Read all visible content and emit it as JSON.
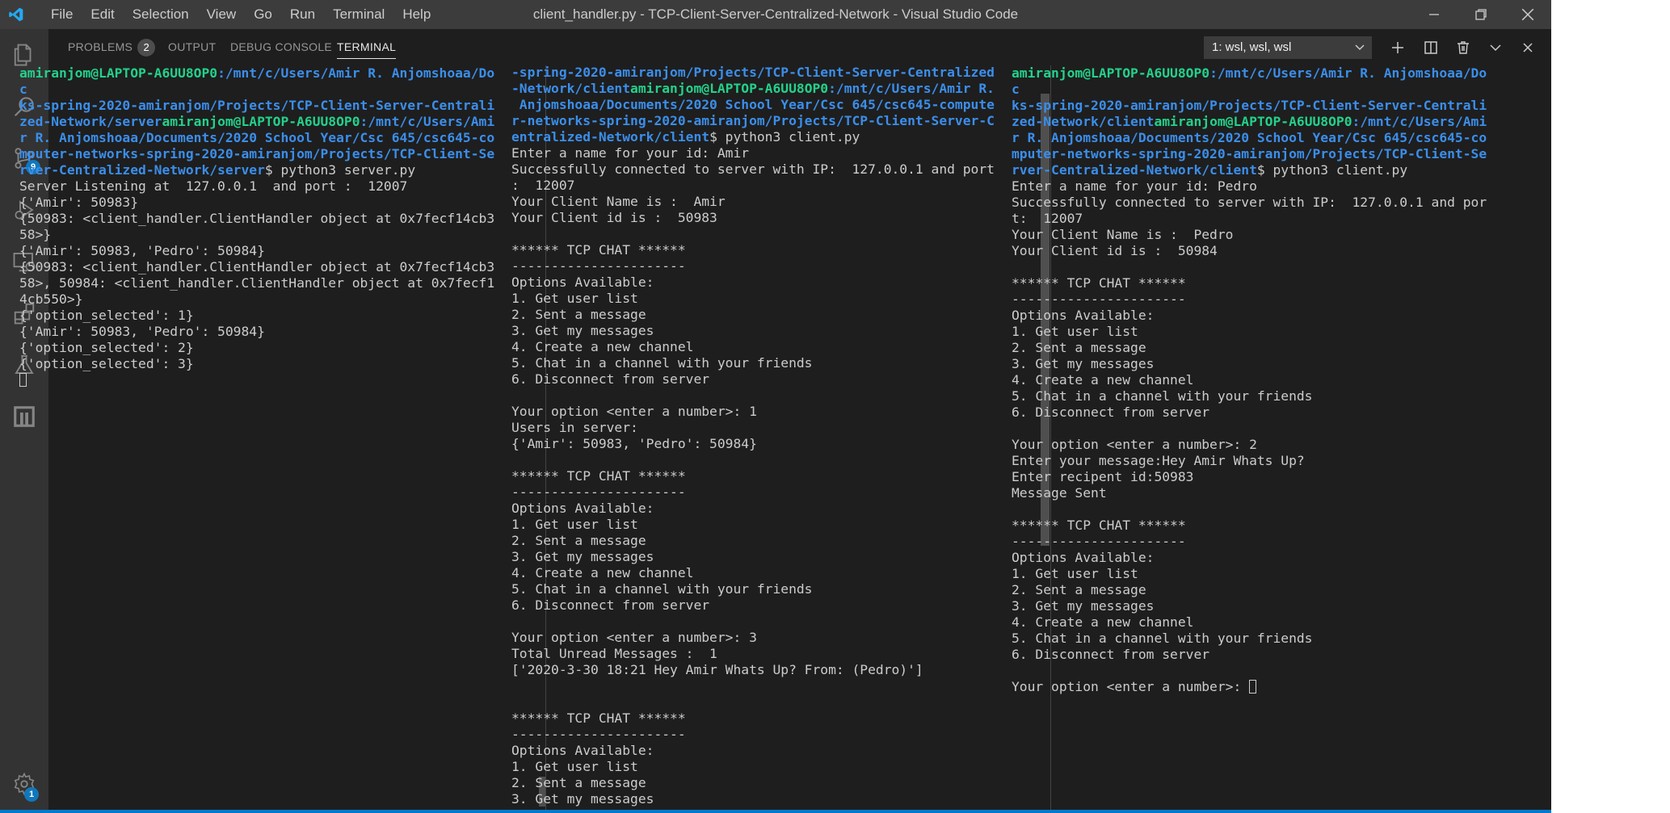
{
  "window": {
    "title": "client_handler.py - TCP-Client-Server-Centralized-Network - Visual Studio Code",
    "menus": [
      "File",
      "Edit",
      "Selection",
      "View",
      "Go",
      "Run",
      "Terminal",
      "Help"
    ]
  },
  "activity": {
    "scm_badge": "9",
    "settings_badge": "1"
  },
  "panel": {
    "tabs": {
      "problems": "PROBLEMS",
      "problems_count": "2",
      "output": "OUTPUT",
      "debug": "DEBUG CONSOLE",
      "terminal": "TERMINAL"
    },
    "terminal_select": "1: wsl, wsl, wsl"
  },
  "terminals": {
    "server": {
      "lines": [
        [
          {
            "t": "amiranjom@LAPTOP-A6UU8OP0",
            "c": "u"
          },
          {
            "t": ":/mnt/c/Users/Amir R. Anjomshoaa/Do",
            "c": "p"
          }
        ],
        [
          {
            "t": "c",
            "c": "p"
          }
        ],
        [
          {
            "t": "ks-spring-2020-amiranjom/Projects/TCP-Client-Server-Centrali",
            "c": "p"
          }
        ],
        [
          {
            "t": "zed-Network/server",
            "c": "p"
          },
          {
            "t": "amiranjom@LAPTOP-A6UU8OP0",
            "c": "u"
          },
          {
            "t": ":/mnt/c/Users/Ami",
            "c": "p"
          }
        ],
        [
          {
            "t": "r R. Anjomshoaa/Documents/2020 School Year/Csc 645/csc645-co",
            "c": "p"
          }
        ],
        [
          {
            "t": "mputer-networks-spring-2020-amiranjom/Projects/TCP-Client-Se",
            "c": "p"
          }
        ],
        [
          {
            "t": "rver-Centralized-Network/server",
            "c": "p"
          },
          {
            "t": "$ python3 server.py",
            "c": ""
          }
        ],
        [
          {
            "t": "Server Listening at  127.0.0.1  and port :  12007",
            "c": ""
          }
        ],
        [
          {
            "t": "{'Amir': 50983}",
            "c": ""
          }
        ],
        [
          {
            "t": "{50983: <client_handler.ClientHandler object at 0x7fecf14cb3",
            "c": ""
          }
        ],
        [
          {
            "t": "58>}",
            "c": ""
          }
        ],
        [
          {
            "t": "{'Amir': 50983, 'Pedro': 50984}",
            "c": ""
          }
        ],
        [
          {
            "t": "{50983: <client_handler.ClientHandler object at 0x7fecf14cb3",
            "c": ""
          }
        ],
        [
          {
            "t": "58>, 50984: <client_handler.ClientHandler object at 0x7fecf1",
            "c": ""
          }
        ],
        [
          {
            "t": "4cb550>}",
            "c": ""
          }
        ],
        [
          {
            "t": "{'option_selected': 1}",
            "c": ""
          }
        ],
        [
          {
            "t": "{'Amir': 50983, 'Pedro': 50984}",
            "c": ""
          }
        ],
        [
          {
            "t": "{'option_selected': 2}",
            "c": ""
          }
        ],
        [
          {
            "t": "{'option_selected': 3}",
            "c": ""
          }
        ],
        [
          {
            "cursor": true
          }
        ]
      ]
    },
    "client_amir": {
      "lines": [
        [
          {
            "t": "-spring-2020-amiranjom/Projects/TCP-Client-Server-Centralized",
            "c": "p"
          }
        ],
        [
          {
            "t": "-Network/client",
            "c": "p"
          },
          {
            "t": "amiranjom@LAPTOP-A6UU8OP0",
            "c": "u"
          },
          {
            "t": ":/mnt/c/Users/Amir R.",
            "c": "p"
          }
        ],
        [
          {
            "t": " Anjomshoaa/Documents/2020 School Year/Csc 645/csc645-compute",
            "c": "p"
          }
        ],
        [
          {
            "t": "r-networks-spring-2020-amiranjom/Projects/TCP-Client-Server-C",
            "c": "p"
          }
        ],
        [
          {
            "t": "entralized-Network/client",
            "c": "p"
          },
          {
            "t": "$ python3 client.py",
            "c": ""
          }
        ],
        [
          {
            "t": "Enter a name for your id: Amir",
            "c": ""
          }
        ],
        [
          {
            "t": "Successfully connected to server with IP:  127.0.0.1 and port",
            "c": ""
          }
        ],
        [
          {
            "t": ":  12007",
            "c": ""
          }
        ],
        [
          {
            "t": "Your Client Name is :  Amir",
            "c": ""
          }
        ],
        [
          {
            "t": "Your Client id is :  50983",
            "c": ""
          }
        ],
        [
          {
            "t": "",
            "c": ""
          }
        ],
        [
          {
            "t": "****** TCP CHAT ******",
            "c": ""
          }
        ],
        [
          {
            "t": "----------------------",
            "c": ""
          }
        ],
        [
          {
            "t": "Options Available:",
            "c": ""
          }
        ],
        [
          {
            "t": "1. Get user list",
            "c": ""
          }
        ],
        [
          {
            "t": "2. Sent a message",
            "c": ""
          }
        ],
        [
          {
            "t": "3. Get my messages",
            "c": ""
          }
        ],
        [
          {
            "t": "4. Create a new channel",
            "c": ""
          }
        ],
        [
          {
            "t": "5. Chat in a channel with your friends",
            "c": ""
          }
        ],
        [
          {
            "t": "6. Disconnect from server",
            "c": ""
          }
        ],
        [
          {
            "t": "",
            "c": ""
          }
        ],
        [
          {
            "t": "Your option <enter a number>: 1",
            "c": ""
          }
        ],
        [
          {
            "t": "Users in server:",
            "c": ""
          }
        ],
        [
          {
            "t": "{'Amir': 50983, 'Pedro': 50984}",
            "c": ""
          }
        ],
        [
          {
            "t": "",
            "c": ""
          }
        ],
        [
          {
            "t": "****** TCP CHAT ******",
            "c": ""
          }
        ],
        [
          {
            "t": "----------------------",
            "c": ""
          }
        ],
        [
          {
            "t": "Options Available:",
            "c": ""
          }
        ],
        [
          {
            "t": "1. Get user list",
            "c": ""
          }
        ],
        [
          {
            "t": "2. Sent a message",
            "c": ""
          }
        ],
        [
          {
            "t": "3. Get my messages",
            "c": ""
          }
        ],
        [
          {
            "t": "4. Create a new channel",
            "c": ""
          }
        ],
        [
          {
            "t": "5. Chat in a channel with your friends",
            "c": ""
          }
        ],
        [
          {
            "t": "6. Disconnect from server",
            "c": ""
          }
        ],
        [
          {
            "t": "",
            "c": ""
          }
        ],
        [
          {
            "t": "Your option <enter a number>: 3",
            "c": ""
          }
        ],
        [
          {
            "t": "Total Unread Messages :  1",
            "c": ""
          }
        ],
        [
          {
            "t": "['2020-3-30 18:21 Hey Amir Whats Up? From: (Pedro)']",
            "c": ""
          }
        ],
        [
          {
            "t": "",
            "c": ""
          }
        ],
        [
          {
            "t": "",
            "c": ""
          }
        ],
        [
          {
            "t": "****** TCP CHAT ******",
            "c": ""
          }
        ],
        [
          {
            "t": "----------------------",
            "c": ""
          }
        ],
        [
          {
            "t": "Options Available:",
            "c": ""
          }
        ],
        [
          {
            "t": "1. Get user list",
            "c": ""
          }
        ],
        [
          {
            "t": "2. Sent a message",
            "c": ""
          }
        ],
        [
          {
            "t": "3. Get my messages",
            "c": ""
          }
        ]
      ]
    },
    "client_pedro": {
      "lines": [
        [
          {
            "t": "amiranjom@LAPTOP-A6UU8OP0",
            "c": "u"
          },
          {
            "t": ":/mnt/c/Users/Amir R. Anjomshoaa/Do",
            "c": "p"
          }
        ],
        [
          {
            "t": "c",
            "c": "p"
          }
        ],
        [
          {
            "t": "ks-spring-2020-amiranjom/Projects/TCP-Client-Server-Centrali",
            "c": "p"
          }
        ],
        [
          {
            "t": "zed-Network/client",
            "c": "p"
          },
          {
            "t": "amiranjom@LAPTOP-A6UU8OP0",
            "c": "u"
          },
          {
            "t": ":/mnt/c/Users/Ami",
            "c": "p"
          }
        ],
        [
          {
            "t": "r R. Anjomshoaa/Documents/2020 School Year/Csc 645/csc645-co",
            "c": "p"
          }
        ],
        [
          {
            "t": "mputer-networks-spring-2020-amiranjom/Projects/TCP-Client-Se",
            "c": "p"
          }
        ],
        [
          {
            "t": "rver-Centralized-Network/client",
            "c": "p"
          },
          {
            "t": "$ python3 client.py",
            "c": ""
          }
        ],
        [
          {
            "t": "Enter a name for your id: Pedro",
            "c": ""
          }
        ],
        [
          {
            "t": "Successfully connected to server with IP:  127.0.0.1 and por",
            "c": ""
          }
        ],
        [
          {
            "t": "t:  12007",
            "c": ""
          }
        ],
        [
          {
            "t": "Your Client Name is :  Pedro",
            "c": ""
          }
        ],
        [
          {
            "t": "Your Client id is :  50984",
            "c": ""
          }
        ],
        [
          {
            "t": "",
            "c": ""
          }
        ],
        [
          {
            "t": "****** TCP CHAT ******",
            "c": ""
          }
        ],
        [
          {
            "t": "----------------------",
            "c": ""
          }
        ],
        [
          {
            "t": "Options Available:",
            "c": ""
          }
        ],
        [
          {
            "t": "1. Get user list",
            "c": ""
          }
        ],
        [
          {
            "t": "2. Sent a message",
            "c": ""
          }
        ],
        [
          {
            "t": "3. Get my messages",
            "c": ""
          }
        ],
        [
          {
            "t": "4. Create a new channel",
            "c": ""
          }
        ],
        [
          {
            "t": "5. Chat in a channel with your friends",
            "c": ""
          }
        ],
        [
          {
            "t": "6. Disconnect from server",
            "c": ""
          }
        ],
        [
          {
            "t": "",
            "c": ""
          }
        ],
        [
          {
            "t": "Your option <enter a number>: 2",
            "c": ""
          }
        ],
        [
          {
            "t": "Enter your message:Hey Amir Whats Up?",
            "c": ""
          }
        ],
        [
          {
            "t": "Enter recipent id:50983",
            "c": ""
          }
        ],
        [
          {
            "t": "Message Sent",
            "c": ""
          }
        ],
        [
          {
            "t": "",
            "c": ""
          }
        ],
        [
          {
            "t": "****** TCP CHAT ******",
            "c": ""
          }
        ],
        [
          {
            "t": "----------------------",
            "c": ""
          }
        ],
        [
          {
            "t": "Options Available:",
            "c": ""
          }
        ],
        [
          {
            "t": "1. Get user list",
            "c": ""
          }
        ],
        [
          {
            "t": "2. Sent a message",
            "c": ""
          }
        ],
        [
          {
            "t": "3. Get my messages",
            "c": ""
          }
        ],
        [
          {
            "t": "4. Create a new channel",
            "c": ""
          }
        ],
        [
          {
            "t": "5. Chat in a channel with your friends",
            "c": ""
          }
        ],
        [
          {
            "t": "6. Disconnect from server",
            "c": ""
          }
        ],
        [
          {
            "t": "",
            "c": ""
          }
        ],
        [
          {
            "t": "Your option <enter a number>: ",
            "c": ""
          },
          {
            "cursor": true
          }
        ]
      ]
    }
  }
}
